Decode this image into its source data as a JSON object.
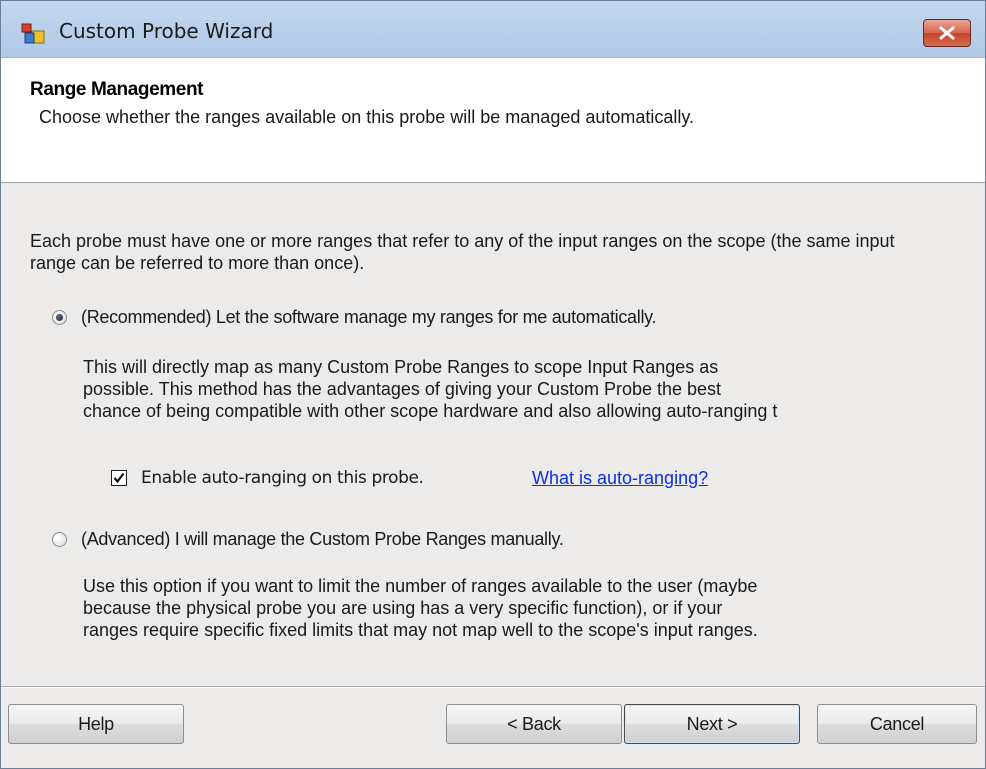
{
  "window": {
    "title": "Custom Probe Wizard",
    "icon": "app-window-icon",
    "close_icon": "close-icon"
  },
  "header": {
    "title": "Range Management",
    "description": "Choose whether the ranges available on this probe will be managed automatically."
  },
  "content": {
    "intro": "Each probe must have one or more ranges that refer to any of the input ranges on the scope (the same input range can be referred to more than once).",
    "recommended": {
      "label": "(Recommended) Let the software manage my ranges for me automatically.",
      "selected": true,
      "description": "This will directly map as many Custom Probe Ranges to scope Input Ranges as\npossible. This method has the advantages of giving your Custom Probe the best\nchance of being compatible with other scope hardware and also allowing auto-ranging t",
      "auto_ranging": {
        "label": "Enable auto-ranging on this probe.",
        "checked": true,
        "link": "What is auto-ranging?"
      }
    },
    "advanced": {
      "label": "(Advanced) I will manage the Custom Probe Ranges manually.",
      "selected": false,
      "description": "Use this option if you want to limit the number of ranges available to the user (maybe\nbecause the physical probe you are using has a very specific function), or if your\nranges require specific fixed limits that may not map well to the scope's input ranges."
    }
  },
  "footer": {
    "help": "Help",
    "back": "< Back",
    "next": "Next >",
    "cancel": "Cancel"
  },
  "colors": {
    "titlebar": "#c3d7ee",
    "link": "#0b2ee6",
    "close_button": "#d7674f",
    "body_background": "#ecebea"
  }
}
